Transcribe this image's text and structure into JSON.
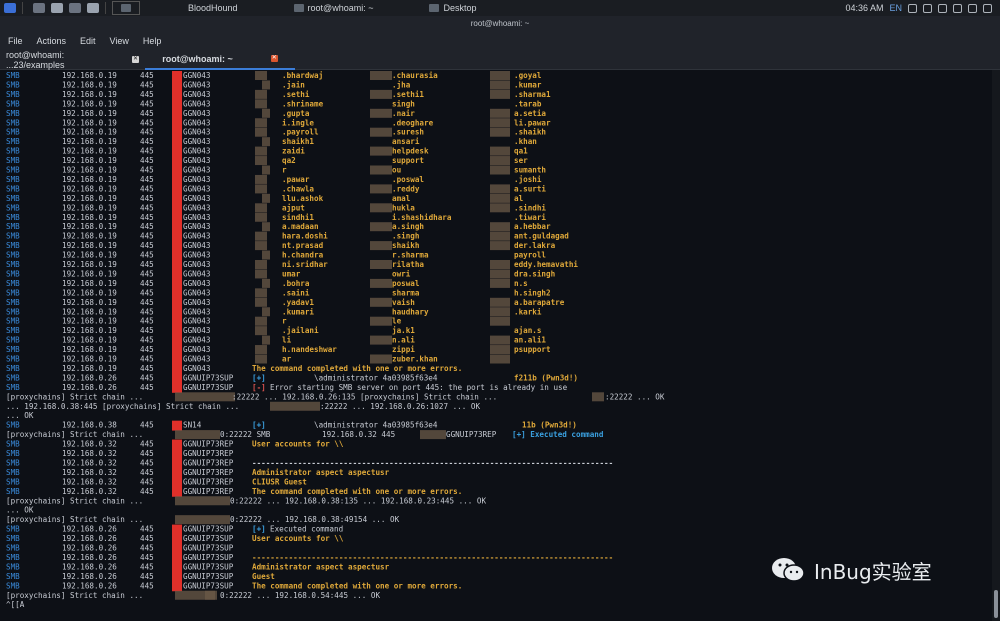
{
  "panel": {
    "tasks": [
      {
        "label": "BloodHound",
        "active": false
      },
      {
        "label": "root@whoami: ~",
        "active": false
      },
      {
        "label": "Desktop",
        "active": false
      }
    ],
    "clock": "04:36 AM",
    "lang": "EN",
    "icons": [
      "kali-menu-icon",
      "files-icon",
      "folder-icon",
      "terminal-icon",
      "blank-window-icon",
      "network-icon",
      "volume-icon",
      "battery-icon",
      "notification-icon",
      "lock-icon",
      "power-icon"
    ]
  },
  "window_title": "root@whoami: ~",
  "menu": [
    "File",
    "Actions",
    "Edit",
    "View",
    "Help"
  ],
  "tabs": [
    {
      "label": "root@whoami: ...23/examples",
      "active": false
    },
    {
      "label": "root@whoami: ~",
      "active": true
    }
  ],
  "watermark": "InBug实验室",
  "colors": {
    "smb": "#3a8ad9",
    "plus": "#3aa0e0",
    "warn": "#e0a93a",
    "err": "#d9534f",
    "redact": "#e0302a"
  },
  "terminal": {
    "smb_rows_1": [
      [
        "SMB",
        "192.168.0.19",
        "445",
        "GGN043",
        ".bhardwaj",
        ".chaurasia",
        ".goyal"
      ],
      [
        "SMB",
        "192.168.0.19",
        "445",
        "GGN043",
        ".jain",
        ".jha",
        ".kumar"
      ],
      [
        "SMB",
        "192.168.0.19",
        "445",
        "GGN043",
        ".sethi",
        ".sethi1",
        ".sharma1"
      ],
      [
        "SMB",
        "192.168.0.19",
        "445",
        "GGN043",
        ".shriname",
        "singh",
        ".tarab"
      ],
      [
        "SMB",
        "192.168.0.19",
        "445",
        "GGN043",
        ".gupta",
        ".nair",
        "a.setia"
      ],
      [
        "SMB",
        "192.168.0.19",
        "445",
        "GGN043",
        "i.ingle",
        ".deoghare",
        "li.pawar"
      ],
      [
        "SMB",
        "192.168.0.19",
        "445",
        "GGN043",
        ".payroll",
        ".suresh",
        ".shaikh"
      ],
      [
        "SMB",
        "192.168.0.19",
        "445",
        "GGN043",
        "shaikh1",
        "ansari",
        ".khan"
      ],
      [
        "SMB",
        "192.168.0.19",
        "445",
        "GGN043",
        "zaidi",
        "helpdesk",
        "qa1"
      ],
      [
        "SMB",
        "192.168.0.19",
        "445",
        "GGN043",
        "qa2",
        "support",
        "ser"
      ],
      [
        "SMB",
        "192.168.0.19",
        "445",
        "GGN043",
        "r",
        "ou",
        "sumanth"
      ],
      [
        "SMB",
        "192.168.0.19",
        "445",
        "GGN043",
        ".pawar",
        ".poswal",
        ".joshi"
      ],
      [
        "SMB",
        "192.168.0.19",
        "445",
        "GGN043",
        ".chawla",
        ".reddy",
        "a.surti"
      ],
      [
        "SMB",
        "192.168.0.19",
        "445",
        "GGN043",
        "llu.ashok",
        "amal",
        "al"
      ],
      [
        "SMB",
        "192.168.0.19",
        "445",
        "GGN043",
        "ajput",
        "hukla",
        ".sindhi"
      ],
      [
        "SMB",
        "192.168.0.19",
        "445",
        "GGN043",
        "sindhi1",
        "i.shashidhara",
        ".tiwari"
      ],
      [
        "SMB",
        "192.168.0.19",
        "445",
        "GGN043",
        "a.madaan",
        "a.singh",
        "a.hebbar"
      ],
      [
        "SMB",
        "192.168.0.19",
        "445",
        "GGN043",
        "hara.doshi",
        ".singh",
        "ant.guldagad"
      ],
      [
        "SMB",
        "192.168.0.19",
        "445",
        "GGN043",
        "nt.prasad",
        "shaikh",
        "der.lakra"
      ],
      [
        "SMB",
        "192.168.0.19",
        "445",
        "GGN043",
        "h.chandra",
        "r.sharma",
        "payroll"
      ],
      [
        "SMB",
        "192.168.0.19",
        "445",
        "GGN043",
        "ni.sridhar",
        "rilatha",
        "eddy.hemavathi"
      ],
      [
        "SMB",
        "192.168.0.19",
        "445",
        "GGN043",
        "umar",
        "owri",
        "dra.singh"
      ],
      [
        "SMB",
        "192.168.0.19",
        "445",
        "GGN043",
        ".bohra",
        "poswal",
        "n.s"
      ],
      [
        "SMB",
        "192.168.0.19",
        "445",
        "GGN043",
        ".saini",
        "sharma",
        "h.singh2"
      ],
      [
        "SMB",
        "192.168.0.19",
        "445",
        "GGN043",
        ".yadav1",
        "vaish",
        "a.barapatre"
      ],
      [
        "SMB",
        "192.168.0.19",
        "445",
        "GGN043",
        ".kumari",
        "haudhary",
        ".karki"
      ],
      [
        "SMB",
        "192.168.0.19",
        "445",
        "GGN043",
        "r",
        "le",
        ""
      ],
      [
        "SMB",
        "192.168.0.19",
        "445",
        "GGN043",
        ".jailani",
        "ja.k1",
        "ajan.s"
      ],
      [
        "SMB",
        "192.168.0.19",
        "445",
        "GGN043",
        "li",
        "n.ali",
        "an.ali1"
      ],
      [
        "SMB",
        "192.168.0.19",
        "445",
        "GGN043",
        "h.nandeshwar",
        "zippi",
        "psupport"
      ],
      [
        "SMB",
        "192.168.0.19",
        "445",
        "GGN043",
        "ar",
        "zuber.khan",
        ""
      ]
    ],
    "completed_1": "The command completed with one or more errors.",
    "row_026_1": [
      "SMB",
      "192.168.0.26",
      "445",
      "GGNUIP73SUP",
      "[+]",
      "\\administrator 4a03985f63e4",
      "f211b (Pwn3d!)"
    ],
    "row_026_2": [
      "SMB",
      "192.168.0.26",
      "445",
      "GGNUIP73SUP",
      "[-]",
      "Error starting SMB server on port 445: the port is already in use"
    ],
    "chain_1a": "[proxychains] Strict chain  ...",
    "chain_1b": ":22222  ...  192.168.0.26:135 [proxychains] Strict chain  ...",
    "chain_1c": ":22222  ...  OK",
    "chain_2a": "  ...  192.168.0.38:445 [proxychains] Strict chain  ...",
    "chain_2b": ":22222  ...  192.168.0.26:1027  ...  OK",
    "ok_line": "  ...  OK",
    "row_038": [
      "SMB",
      "192.168.0.38",
      "445",
      "SN14",
      "[+]",
      "\\administrator 4a03985f63e4",
      "11b (Pwn3d!)"
    ],
    "chain_3a": "[proxychains] Strict chain  ...",
    "chain_3b": "0:22222 SMB",
    "chain_3c": "192.168.0.32    445",
    "chain_3d": "GGNUIP73REP",
    "chain_3e": "[+] Executed command",
    "smb_rows_032": [
      [
        "SMB",
        "192.168.0.32",
        "445",
        "GGNUIP73REP",
        "User accounts for \\\\"
      ],
      [
        "SMB",
        "192.168.0.32",
        "445",
        "GGNUIP73REP",
        ""
      ],
      [
        "SMB",
        "192.168.0.32",
        "445",
        "GGNUIP73REP",
        "-------------------------------------------------------------------------------"
      ],
      [
        "SMB",
        "192.168.0.32",
        "445",
        "GGNUIP73REP",
        "Administrator          aspect              aspectusr"
      ],
      [
        "SMB",
        "192.168.0.32",
        "445",
        "GGNUIP73REP",
        "CLIUSR                 Guest"
      ],
      [
        "SMB",
        "192.168.0.32",
        "445",
        "GGNUIP73REP",
        "The command completed with one or more errors."
      ]
    ],
    "chain_4a": "[proxychains] Strict chain  ...",
    "chain_4b": "0:22222  ...  192.168.0.38:135  ...  192.168.0.23:445  ...  OK",
    "ok_line2": "  ...  OK",
    "chain_5a": "[proxychains] Strict chain  ...",
    "chain_5b": "0:22222  ...  192.168.0.38:49154  ...  OK",
    "smb_rows_026": [
      [
        "SMB",
        "192.168.0.26",
        "445",
        "GGNUIP73SUP",
        "[+] Executed command"
      ],
      [
        "SMB",
        "192.168.0.26",
        "445",
        "GGNUIP73SUP",
        "User accounts for \\\\"
      ],
      [
        "SMB",
        "192.168.0.26",
        "445",
        "GGNUIP73SUP",
        ""
      ],
      [
        "SMB",
        "192.168.0.26",
        "445",
        "GGNUIP73SUP",
        "-------------------------------------------------------------------------------"
      ],
      [
        "SMB",
        "192.168.0.26",
        "445",
        "GGNUIP73SUP",
        "Administrator          aspect              aspectusr"
      ],
      [
        "SMB",
        "192.168.0.26",
        "445",
        "GGNUIP73SUP",
        "Guest"
      ],
      [
        "SMB",
        "192.168.0.26",
        "445",
        "GGNUIP73SUP",
        "The command completed with one or more errors."
      ]
    ],
    "chain_6a": "[proxychains] Strict chain  ...",
    "chain_6b": "0:22222  ...  192.168.0.54:445  ...  OK",
    "prompt": "^[[A"
  }
}
